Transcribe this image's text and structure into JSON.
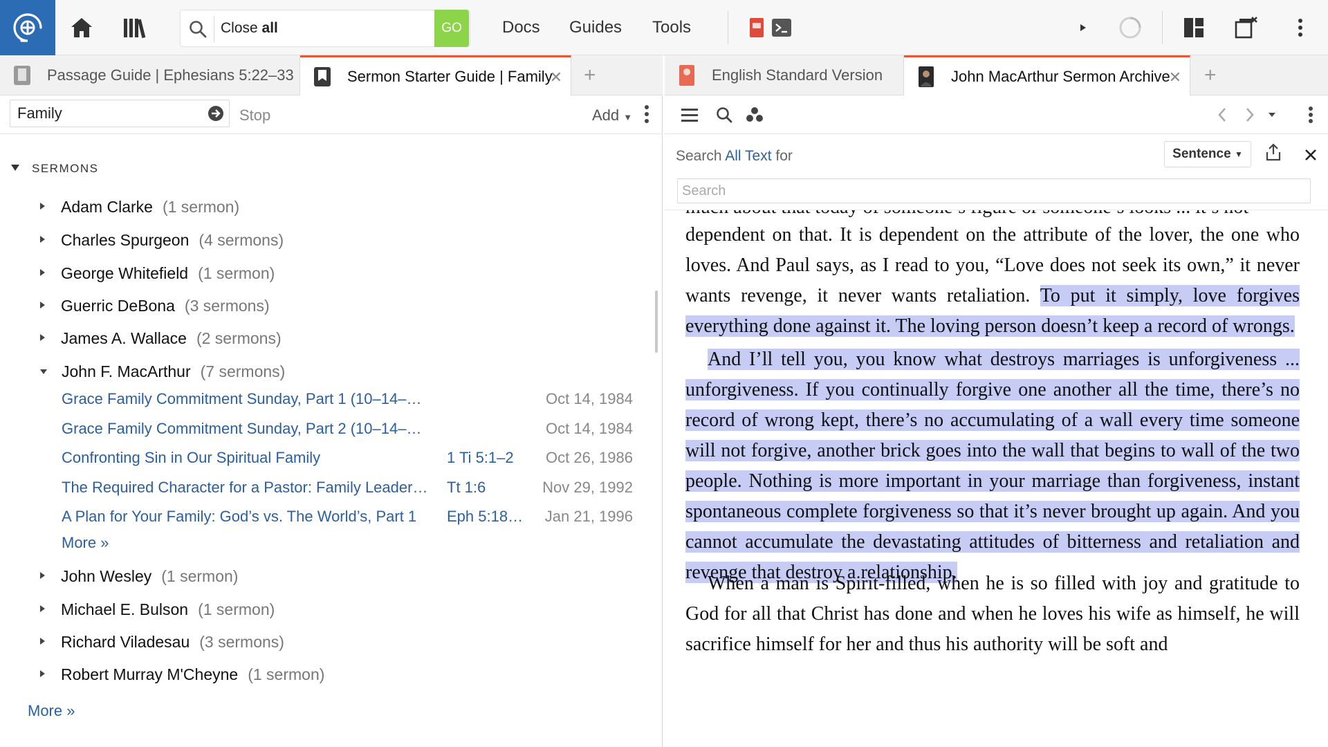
{
  "toolbar": {
    "command_value": "Close ",
    "command_bold": "all",
    "go_label": "GO",
    "menus": [
      "Docs",
      "Guides",
      "Tools"
    ]
  },
  "tabs_left": [
    {
      "label": "Passage Guide | Ephesians 5:22–33",
      "active": false
    },
    {
      "label": "Sermon Starter Guide | Family",
      "active": true
    }
  ],
  "tabs_right": [
    {
      "label": "English Standard Version",
      "active": false
    },
    {
      "label": "John MacArthur Sermon Archive",
      "active": true
    }
  ],
  "guide": {
    "topic_value": "Family",
    "stop_label": "Stop",
    "add_label": "Add",
    "section_title": "SERMONS",
    "authors": [
      {
        "name": "Adam Clarke",
        "count": "(1 sermon)",
        "expanded": false
      },
      {
        "name": "Charles Spurgeon",
        "count": "(4 sermons)",
        "expanded": false
      },
      {
        "name": "George Whitefield",
        "count": "(1 sermon)",
        "expanded": false
      },
      {
        "name": "Guerric DeBona",
        "count": "(3 sermons)",
        "expanded": false
      },
      {
        "name": "James A. Wallace",
        "count": "(2 sermons)",
        "expanded": false
      },
      {
        "name": "John F. MacArthur",
        "count": "(7 sermons)",
        "expanded": true
      },
      {
        "name": "John Wesley",
        "count": "(1 sermon)",
        "expanded": false
      },
      {
        "name": "Michael E. Bulson",
        "count": "(1 sermon)",
        "expanded": false
      },
      {
        "name": "Richard Viladesau",
        "count": "(3 sermons)",
        "expanded": false
      },
      {
        "name": "Robert Murray M'Cheyne",
        "count": "(1 sermon)",
        "expanded": false
      }
    ],
    "sermons": [
      {
        "title": "Grace Family Commitment Sunday, Part 1 (10–14–…",
        "ref": "",
        "date": "Oct 14, 1984"
      },
      {
        "title": "Grace Family Commitment Sunday, Part 2 (10–14–…",
        "ref": "",
        "date": "Oct 14, 1984"
      },
      {
        "title": "Confronting Sin in Our Spiritual Family",
        "ref": "1 Ti 5:1–2",
        "date": "Oct 26, 1986"
      },
      {
        "title": "The Required Character for a Pastor: Family Leader…",
        "ref": "Tt 1:6",
        "date": "Nov 29, 1992"
      },
      {
        "title": "A Plan for Your Family: God’s vs. The World’s, Part 1",
        "ref": "Eph 5:18…",
        "date": "Jan 21, 1996"
      }
    ],
    "sermons_more": "More »",
    "section_more": "More »"
  },
  "reader_search": {
    "prefix": "Search ",
    "scope": "All Text",
    "suffix": " for",
    "mode": "Sentence",
    "placeholder": "Search"
  },
  "reader": {
    "cut_line": "much about that today of someone’s figure or someone’s looks ... it’s not",
    "p1_plain": "dependent on that. It is dependent on the attribute of the lover, the one who loves. And Paul says, as I read to you, “Love does not seek its own,” it never wants revenge, it never wants retaliation. ",
    "p1_highlight": "To put it simply, love forgives everything done against it. The loving person doesn’t keep a record of wrongs.",
    "p2_highlight": "And I’ll tell you, you know what destroys marriages is unforgiveness ... unforgiveness. If you continually forgive one another all the time, there’s no record of wrong kept, there’s no accumulating of a wall every time someone will not forgive, another brick goes into the wall that begins to wall of the two people. Nothing is more important in your marriage than forgiveness, instant spontaneous complete forgiveness so that it’s never brought up again. And you cannot accumulate the devastating attitudes of bitterness and retaliation and revenge that destroy a relationship.",
    "p3_plain": "When a man is Spirit-filled, when he is so filled with joy and gratitude to God for all that Christ has done and when he loves his wife as himself, he will sacrifice himself for her and thus his authority will be soft and",
    "highlight_color": "#c7ccf4"
  },
  "colors": {
    "brand": "#2c6cb4",
    "go_green": "#8cd44a",
    "active_tab_accent": "#e8563a",
    "link": "#2c5f9e"
  }
}
